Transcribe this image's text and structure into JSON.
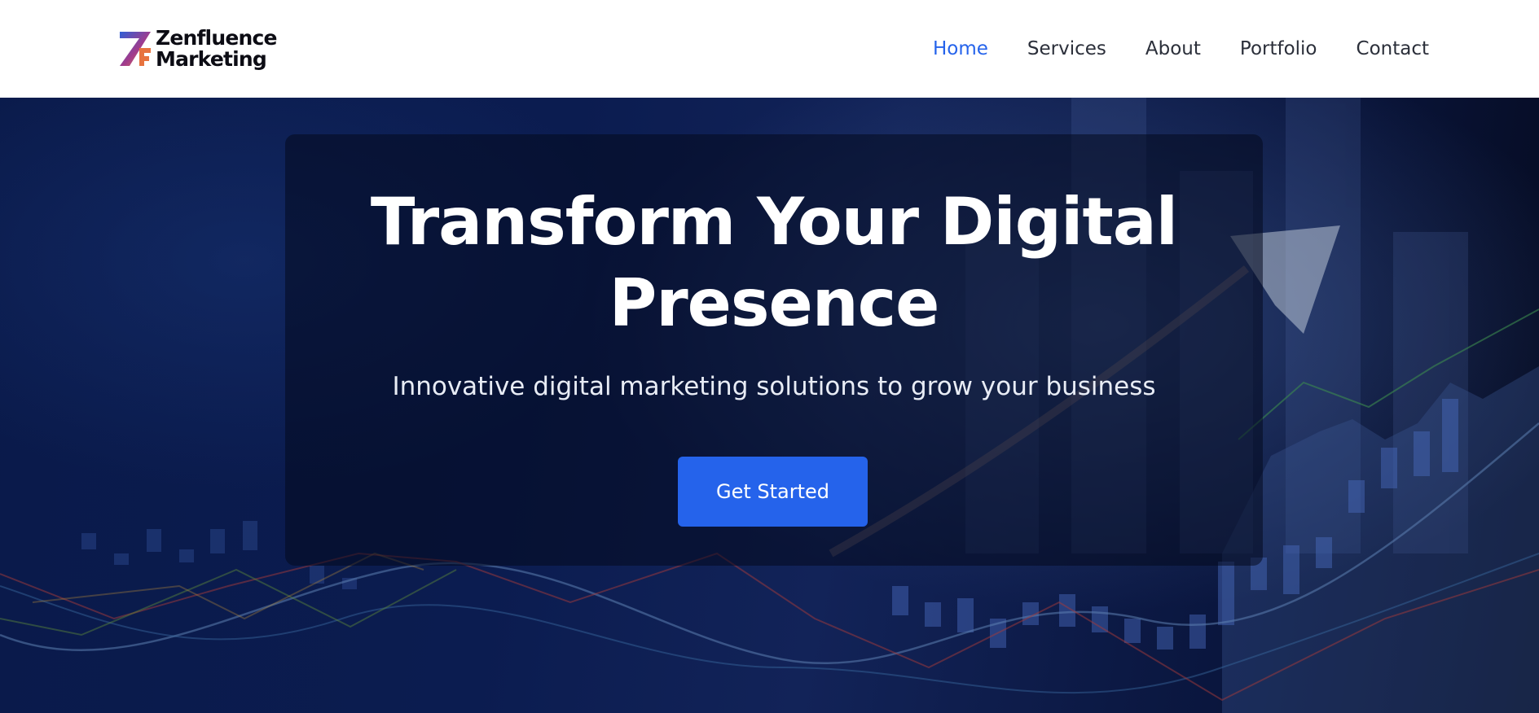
{
  "brand": {
    "line1": "Zenfluence",
    "line2": "Marketing",
    "logo_icon": "zf-logo-mark",
    "gradient_colors": [
      "#2f5fd6",
      "#a23b8c",
      "#f08a3c"
    ]
  },
  "nav": {
    "items": [
      {
        "label": "Home",
        "active": true
      },
      {
        "label": "Services",
        "active": false
      },
      {
        "label": "About",
        "active": false
      },
      {
        "label": "Portfolio",
        "active": false
      },
      {
        "label": "Contact",
        "active": false
      }
    ]
  },
  "hero": {
    "title": "Transform Your Digital Presence",
    "subtitle": "Innovative digital marketing solutions to grow your business",
    "cta_label": "Get Started"
  },
  "colors": {
    "accent": "#2563eb",
    "nav_text": "#2b2f3a",
    "hero_bg_dark": "#0a1a4a",
    "header_bg": "#ffffff"
  }
}
